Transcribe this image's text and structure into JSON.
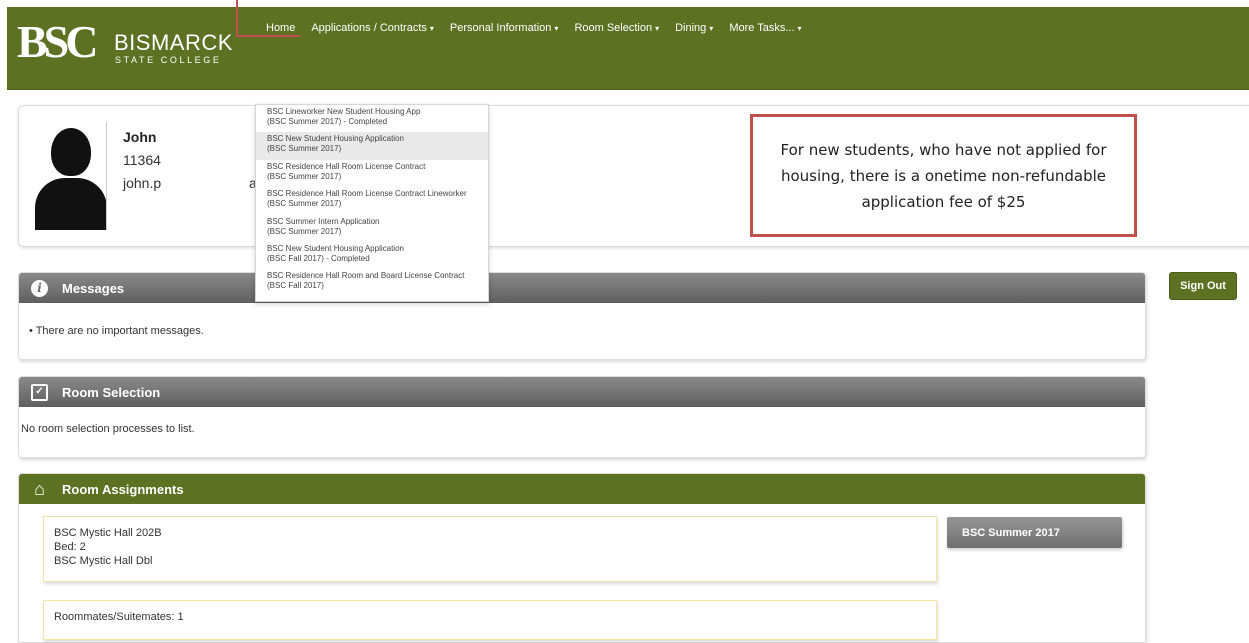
{
  "brand": {
    "mark": "BSC",
    "name": "BISMARCK",
    "subtitle": "STATE COLLEGE"
  },
  "nav": {
    "items": [
      {
        "label": "Home",
        "has_caret": false
      },
      {
        "label": "Applications / Contracts",
        "has_caret": true
      },
      {
        "label": "Personal Information",
        "has_caret": true
      },
      {
        "label": "Room Selection",
        "has_caret": true
      },
      {
        "label": "Dining",
        "has_caret": true
      },
      {
        "label": "More Tasks...",
        "has_caret": true
      }
    ],
    "caret": "▾"
  },
  "profile": {
    "name": "John",
    "id": "11364",
    "email": "john.p",
    "email_tail": "a"
  },
  "dropdown": {
    "items": [
      {
        "line1": "BSC Lineworker New Student Housing App",
        "line2": "(BSC Summer 2017) - Completed"
      },
      {
        "line1": "BSC New Student Housing Application",
        "line2": "(BSC Summer 2017)"
      },
      {
        "line1": "BSC Residence Hall Room License Contract",
        "line2": "(BSC Summer 2017)"
      },
      {
        "line1": "BSC Residence Hall Room License Contract Lineworker",
        "line2": "(BSC Summer 2017)"
      },
      {
        "line1": "BSC Summer Intern Application",
        "line2": "(BSC Summer 2017)"
      },
      {
        "line1": "BSC New Student Housing Application",
        "line2": "(BSC Fall 2017) - Completed"
      },
      {
        "line1": "BSC Residence Hall Room and Board License Contract",
        "line2": "(BSC Fall 2017)"
      }
    ]
  },
  "note": {
    "text": "For new students, who have not applied for housing, there is a onetime non-refundable application fee of $25"
  },
  "messages": {
    "title": "Messages",
    "icon": "info-icon",
    "body": "• There are no important messages."
  },
  "room_selection": {
    "title": "Room Selection",
    "icon": "checkbox-icon",
    "body": "No room selection processes to list."
  },
  "room_assignments": {
    "title": "Room Assignments",
    "icon": "home-icon",
    "room": {
      "hall": "BSC Mystic Hall 202B",
      "bed": "Bed: 2",
      "type": "BSC Mystic Hall Dbl"
    },
    "roommates": "Roommates/Suitemates: 1",
    "term": "BSC Summer 2017"
  },
  "sign_out": {
    "label": "Sign Out"
  },
  "colors": {
    "brand_green": "#5c7222",
    "callout_red": "#c0504d",
    "panel_gray": "#707070"
  }
}
